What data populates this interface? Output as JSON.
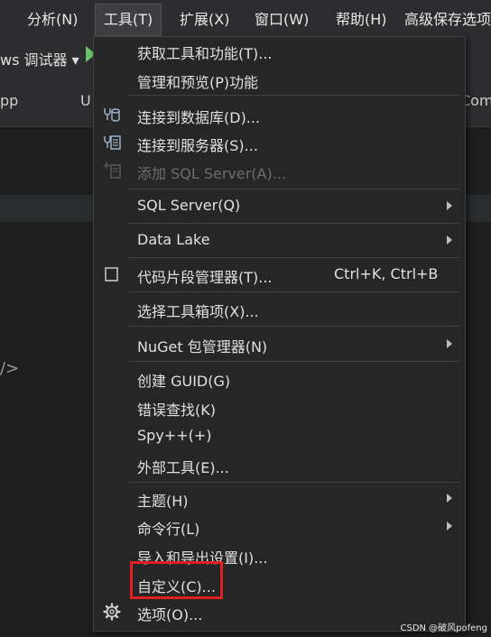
{
  "menubar": {
    "items": [
      {
        "label": "分析(N)"
      },
      {
        "label": "工具(T)"
      },
      {
        "label": "扩展(X)"
      },
      {
        "label": "窗口(W)"
      },
      {
        "label": "帮助(H)"
      },
      {
        "label": "高级保存选项"
      }
    ]
  },
  "toolbar": {
    "debugger_label": "ws 调试器 ▾"
  },
  "tabs": {
    "left": "pp",
    "u": "U",
    "right": "Com"
  },
  "editor": {
    "code_fragment": "/>"
  },
  "tools_menu": {
    "items": [
      {
        "label": "获取工具和功能(T)..."
      },
      {
        "label": "管理和预览(P)功能"
      },
      {
        "label": "连接到数据库(D)..."
      },
      {
        "label": "连接到服务器(S)..."
      },
      {
        "label": "添加 SQL Server(A)...",
        "disabled": true
      },
      {
        "label": "SQL Server(Q)"
      },
      {
        "label": "Data Lake"
      },
      {
        "label": "代码片段管理器(T)...",
        "shortcut": "Ctrl+K, Ctrl+B"
      },
      {
        "label": "选择工具箱项(X)..."
      },
      {
        "label": "NuGet 包管理器(N)"
      },
      {
        "label": "创建 GUID(G)"
      },
      {
        "label": "错误查找(K)"
      },
      {
        "label": "Spy++(+)"
      },
      {
        "label": "外部工具(E)..."
      },
      {
        "label": "主题(H)"
      },
      {
        "label": "命令行(L)"
      },
      {
        "label": "导入和导出设置(I)..."
      },
      {
        "label": "自定义(C)..."
      },
      {
        "label": "选项(O)..."
      }
    ]
  },
  "watermark": "CSDN @破风pofeng",
  "colors": {
    "highlight_box": "#e02020",
    "menu_bg": "#262626",
    "menubar_bg": "#2d2d30"
  }
}
